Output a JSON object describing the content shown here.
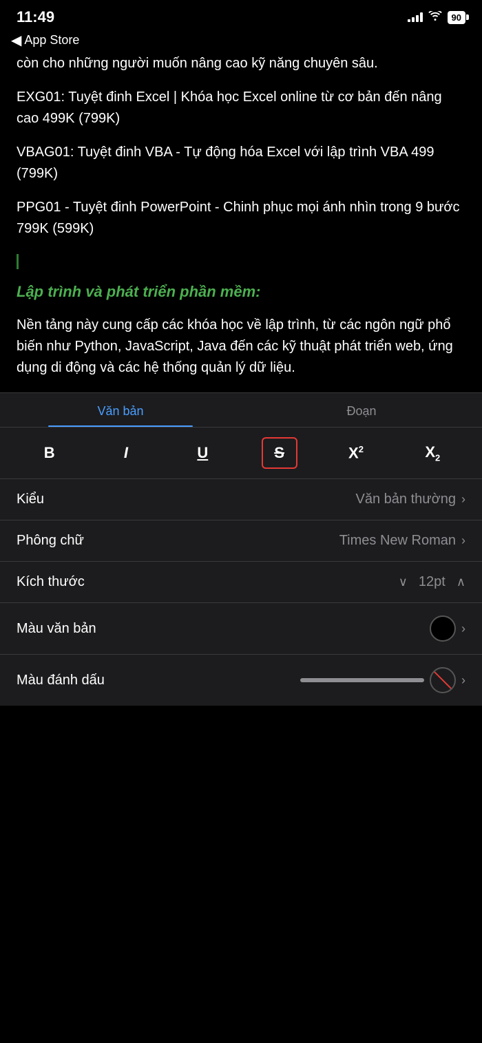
{
  "statusBar": {
    "time": "11:49",
    "battery": "90"
  },
  "navBar": {
    "backLabel": "App Store"
  },
  "content": {
    "paragraph1": "còn cho những người muốn nâng cao kỹ năng chuyên sâu.",
    "course1": "EXG01: Tuyệt đinh Excel | Khóa học Excel online từ cơ bản đến nâng cao 499K (799K)",
    "course2": "VBAG01: Tuyệt đinh VBA - Tự động hóa Excel với lập trình VBA 499 (799K)",
    "course3": "PPG01 - Tuyệt đinh PowerPoint - Chinh phục mọi ánh nhìn trong 9 bước 799K (599K)",
    "sectionTitle": "Lập trình và phát triển phần mềm:",
    "sectionBody": "Nền tảng này cung cấp các khóa học về lập trình, từ các ngôn ngữ phổ biến như Python, JavaScript, Java đến các kỹ thuật phát triển web, ứng dụng di động và các hệ thống quản lý dữ liệu."
  },
  "tabs": [
    {
      "id": "van-ban",
      "label": "Văn bản",
      "active": true
    },
    {
      "id": "doan",
      "label": "Đoạn",
      "active": false
    }
  ],
  "formatButtons": [
    {
      "id": "bold",
      "label": "B",
      "type": "bold"
    },
    {
      "id": "italic",
      "label": "I",
      "type": "italic"
    },
    {
      "id": "underline",
      "label": "U",
      "type": "underline"
    },
    {
      "id": "strikethrough",
      "label": "S",
      "type": "strikethrough"
    },
    {
      "id": "superscript",
      "label": "X²",
      "type": "superscript"
    },
    {
      "id": "subscript",
      "label": "X₂",
      "type": "subscript"
    }
  ],
  "settings": {
    "style": {
      "label": "Kiểu",
      "value": "Văn bản thường"
    },
    "font": {
      "label": "Phông chữ",
      "value": "Times New Roman"
    },
    "size": {
      "label": "Kích thước",
      "value": "12pt"
    },
    "textColor": {
      "label": "Màu văn bản"
    },
    "highlight": {
      "label": "Màu đánh dấu"
    }
  }
}
